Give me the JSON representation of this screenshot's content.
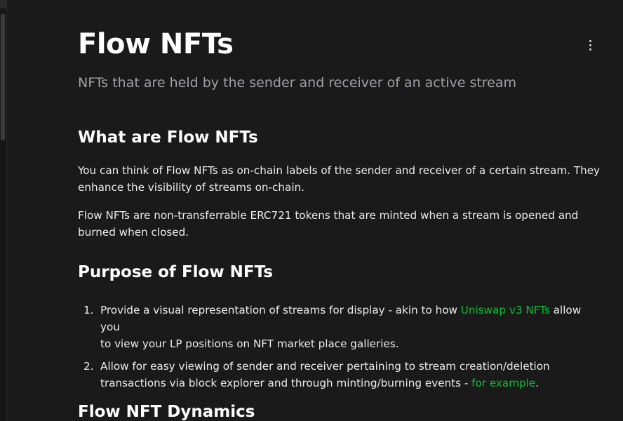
{
  "page": {
    "title": "Flow NFTs",
    "subtitle": "NFTs that are held by the sender and receiver of an active stream"
  },
  "sections": {
    "what": {
      "heading": "What are Flow NFTs",
      "p1_line1": "You can think of Flow NFTs as on-chain labels of the sender and receiver of a certain stream. They",
      "p1_line2": "enhance the visibility of streams on-chain.",
      "p2_line1": "Flow NFTs are non-transferrable ERC721 tokens that are minted when a stream is opened and",
      "p2_line2": "burned when closed."
    },
    "purpose": {
      "heading": "Purpose of Flow NFTs",
      "items": [
        {
          "num": "1.",
          "text_before": "Provide a visual representation of streams for display - akin to how ",
          "link": "Uniswap v3 NFTs",
          "text_after_line1": " allow you",
          "line2": "to view your LP positions on NFT market place galleries."
        },
        {
          "num": "2.",
          "line1": "Allow for easy viewing of sender and receiver pertaining to stream creation/deletion",
          "line2_before": "transactions via block explorer and through minting/burning events - ",
          "link": "for example",
          "line2_after": "."
        }
      ]
    },
    "dynamics": {
      "heading": "Flow NFT Dynamics"
    }
  },
  "icons": {
    "more": "kebab-vertical-icon"
  },
  "colors": {
    "background": "#1a1a1b",
    "link": "#10bb35",
    "subtitle": "#9ea0a6"
  }
}
